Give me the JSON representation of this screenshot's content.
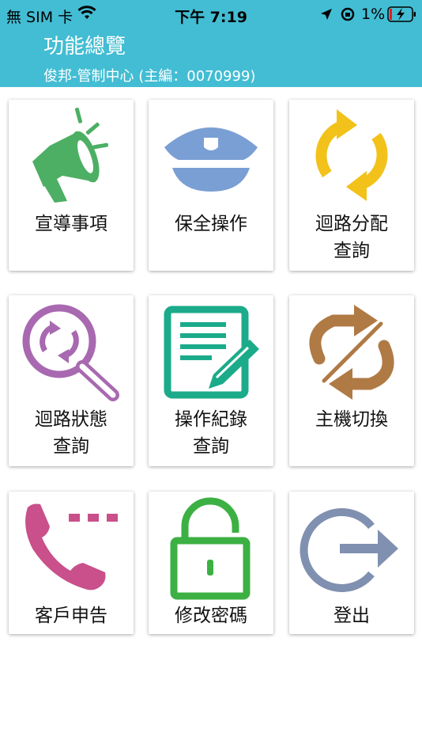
{
  "status_bar": {
    "carrier": "無 SIM 卡",
    "time": "下午 7:19",
    "battery": "1%"
  },
  "header": {
    "title": "功能總覽",
    "subtitle": "俊邦-管制中心 (主編：0070999)"
  },
  "tiles": [
    {
      "label": "宣導事項",
      "icon": "megaphone-icon",
      "color": "#4caf64"
    },
    {
      "label": "保全操作",
      "icon": "police-cap-icon",
      "color": "#7a9fd4"
    },
    {
      "label": "迴路分配\n查詢",
      "icon": "refresh-arrows-icon",
      "color": "#f2c21b"
    },
    {
      "label": "迴路狀態\n查詢",
      "icon": "search-refresh-icon",
      "color": "#a869b0"
    },
    {
      "label": "操作紀錄\n查詢",
      "icon": "edit-document-icon",
      "color": "#1bab8a"
    },
    {
      "label": "主機切換",
      "icon": "switch-arrows-icon",
      "color": "#b07a45"
    },
    {
      "label": "客戶申告",
      "icon": "phone-icon",
      "color": "#c9508a"
    },
    {
      "label": "修改密碼",
      "icon": "unlock-icon",
      "color": "#3cb043"
    },
    {
      "label": "登出",
      "icon": "logout-icon",
      "color": "#8090b0"
    }
  ]
}
